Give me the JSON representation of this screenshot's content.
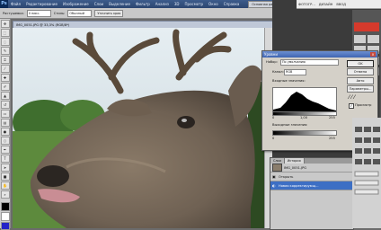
{
  "menubar": {
    "logo": "Ps",
    "items": [
      "Файл",
      "Редактирование",
      "Изображение",
      "Слои",
      "Выделение",
      "Фильтр",
      "Анализ",
      "3D",
      "Просмотр",
      "Окно",
      "Справка"
    ],
    "workspace": "Основная рабочая среда"
  },
  "optionsbar": {
    "feather_label": "Растушевка:",
    "feather_value": "0 пикс.",
    "style_label": "Стиль:",
    "style_value": "Обычный",
    "refine_button": "Уточнить края"
  },
  "toolbox": {
    "tools": [
      "move-icon",
      "marquee-icon",
      "lasso-icon",
      "quick-select-icon",
      "crop-icon",
      "eyedropper-icon",
      "healing-icon",
      "brush-icon",
      "stamp-icon",
      "history-brush-icon",
      "eraser-icon",
      "gradient-icon",
      "blur-icon",
      "dodge-icon",
      "pen-icon",
      "type-icon",
      "path-select-icon",
      "shape-icon",
      "hand-icon",
      "zoom-icon"
    ]
  },
  "document": {
    "title": "IMG_0051.JPG @ 33,3% (RGB/8*)"
  },
  "app2": {
    "items": [
      "ФОТОГР...",
      "ДИЗАЙН",
      "ВВОД"
    ]
  },
  "levels": {
    "title": "Уровни",
    "preset_label": "Набор:",
    "preset_value": "По умолчанию",
    "channel_label": "Канал:",
    "channel_value": "RGB",
    "input_label": "Входные значения:",
    "input_values": [
      "0",
      "1,00",
      "255"
    ],
    "output_label": "Выходные значения:",
    "output_values": [
      "0",
      "255"
    ],
    "buttons": [
      "OK",
      "Отмена",
      "Авто",
      "Параметры..."
    ],
    "preview_label": "Просмотр",
    "preview_checked": true
  },
  "layers": {
    "tabs": [
      "Слои",
      "История"
    ],
    "rows": [
      {
        "name": "IMG_0051.JPG"
      },
      {
        "name": "Открыть"
      },
      {
        "name": "Новая корректирующ..."
      }
    ]
  },
  "colors": {
    "menubar": "#2c4670",
    "selection": "#3d6fc4",
    "dialog_bg": "#d4d0c8"
  }
}
